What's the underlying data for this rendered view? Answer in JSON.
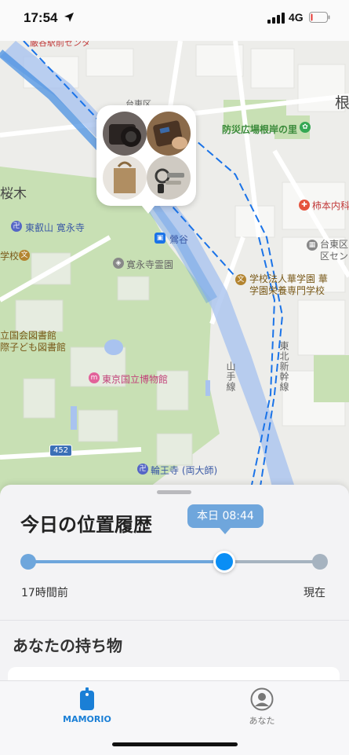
{
  "status_bar": {
    "time": "17:54",
    "network": "4G",
    "battery_level": 0.1,
    "battery_color": "#e53935"
  },
  "map": {
    "labels": {
      "top_cut": "厳谷駅前センタ",
      "top_street": "台東区",
      "park": "防災広場根岸の里",
      "kakimoto": "柿本内科",
      "sakuragi": "桜木",
      "kanneiji": "東叡山 寛永寺",
      "school": "学校",
      "uguisudani": "鶯谷",
      "kanneiji_cemetery": "寛永寺霊園",
      "taito_center": "台東区",
      "taito_center2": "区セン",
      "vocational_1": "学校法人華学園 華",
      "vocational_2": "学園栄養専門学校",
      "library_1": "立国会図書館",
      "library_2": "際子ども図書館",
      "museum": "東京国立博物館",
      "yamanote": "山手線",
      "tohoku": "東北新幹線",
      "rinnoji": "輪王寺 (両大師)",
      "route": "452",
      "negishi": "根"
    },
    "memory_items": [
      {
        "name": "camera",
        "color": "#3a3230"
      },
      {
        "name": "wallet",
        "color": "#5a4030"
      },
      {
        "name": "tote-bag",
        "color": "#a88660"
      },
      {
        "name": "keys",
        "color": "#6b6b66"
      }
    ],
    "colors": {
      "water": "#a9c3ef",
      "park": "#c8e0b4",
      "rail_highlight": "#4a90e2"
    }
  },
  "history": {
    "title": "今日の位置履歴",
    "time_bubble": "本日 08:44",
    "start_label": "17時間前",
    "end_label": "現在",
    "slider_position": 0.67
  },
  "belongings": {
    "title": "あなたの持ち物"
  },
  "tab_bar": {
    "tabs": [
      {
        "label": "MAMORIO",
        "icon": "mamorio-tag-icon",
        "active": true,
        "color": "#1a7fd6"
      },
      {
        "label": "あなた",
        "icon": "person-icon",
        "active": false
      }
    ]
  }
}
